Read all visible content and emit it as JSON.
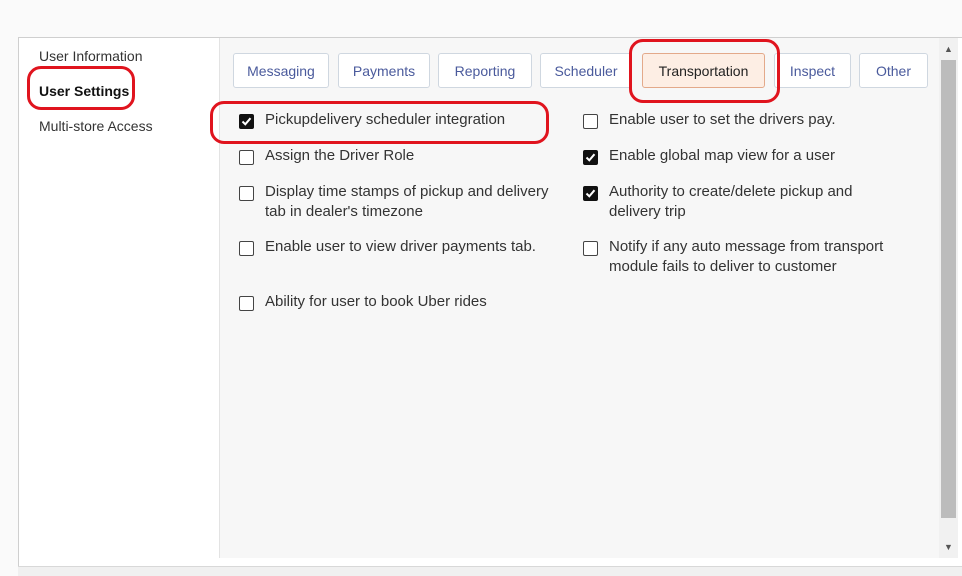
{
  "sidebar": {
    "items": [
      {
        "label": "User Information"
      },
      {
        "label": "User Settings"
      },
      {
        "label": "Multi-store Access"
      }
    ]
  },
  "tabs": [
    {
      "label": "Messaging"
    },
    {
      "label": "Payments"
    },
    {
      "label": "Reporting"
    },
    {
      "label": "Scheduler"
    },
    {
      "label": "Transportation"
    },
    {
      "label": "Inspect"
    },
    {
      "label": "Other"
    }
  ],
  "options": {
    "left": [
      {
        "line1": "Pickupdelivery scheduler integration",
        "line2": "",
        "checked": true
      },
      {
        "line1": "Assign the Driver Role",
        "line2": "",
        "checked": false
      },
      {
        "line1": "Display time stamps of pickup and delivery",
        "line2": "tab in dealer's timezone",
        "checked": false
      },
      {
        "line1": "Enable user to view driver payments tab.",
        "line2": "",
        "checked": false
      },
      {
        "line1": "Ability for user to book Uber rides",
        "line2": "",
        "checked": false
      }
    ],
    "right": [
      {
        "line1": "Enable user to set the drivers pay.",
        "line2": "",
        "checked": false
      },
      {
        "line1": "Enable global map view for a user",
        "line2": "",
        "checked": true
      },
      {
        "line1": "Authority to create/delete pickup and",
        "line2": "delivery trip",
        "checked": true
      },
      {
        "line1": "Notify if any auto message from transport",
        "line2": "module fails to deliver to customer",
        "checked": false
      }
    ]
  },
  "active_tab": "Transportation",
  "active_sidebar": "User Settings",
  "colors": {
    "accent_ring": "#e0141e",
    "tab_text": "#4a5a9c",
    "active_tab_bg": "#fdeee4"
  },
  "icons": {
    "scroll_up": "triangle-up-icon",
    "scroll_down": "triangle-down-icon",
    "check": "checkmark-icon"
  }
}
